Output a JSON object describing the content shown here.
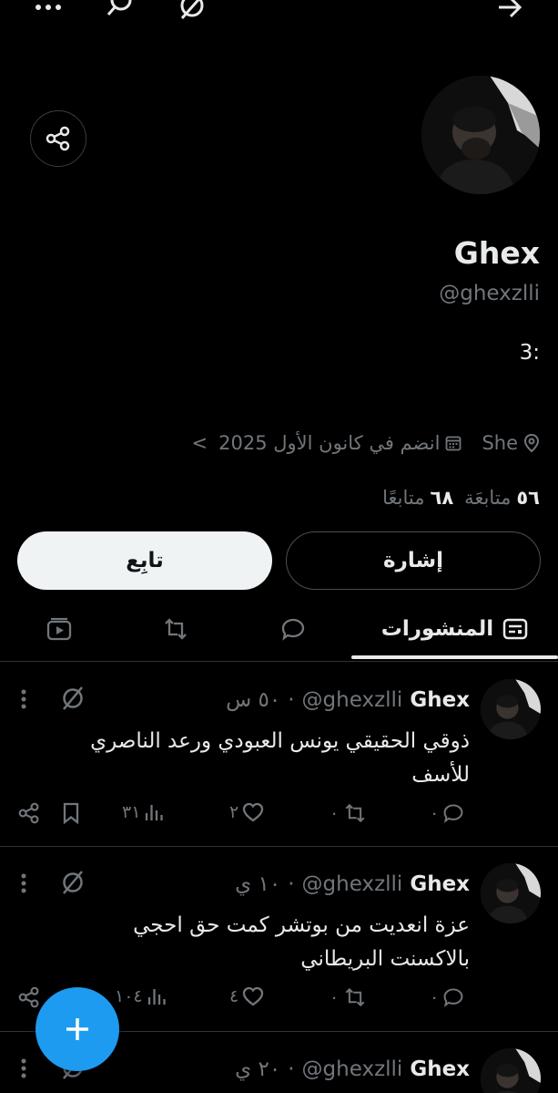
{
  "topbar": {
    "icons": [
      "more-icon",
      "search-icon",
      "grok-icon",
      "back-arrow-icon"
    ]
  },
  "profile": {
    "name": "Ghex",
    "handle": "@ghexzlli",
    "bio": "3:",
    "location": "She",
    "joined": "انضم في كانون الأول 2025",
    "joined_chevron": "<",
    "following_count": "٥٦",
    "following_label": "متابعَة",
    "followers_count": "٦٨",
    "followers_label": "متابعًا"
  },
  "buttons": {
    "mention": "إشارة",
    "follow": "تابِع"
  },
  "tabs": {
    "posts_label": "المنشورات"
  },
  "posts": [
    {
      "name": "Ghex",
      "handle": "@ghexzlli",
      "time": "٥٠ س",
      "dot": "·",
      "text": "ذوقي الحقيقي يونس العبودي ورعد الناصري للأسف",
      "replies": "٠",
      "reposts": "٠",
      "likes": "٢",
      "views": "٣١"
    },
    {
      "name": "Ghex",
      "handle": "@ghexzlli",
      "time": "١٠ ي",
      "dot": "·",
      "text": "عزة انعديت من بوتشر كمت حق احجي بالاكسنت البريطاني",
      "replies": "٠",
      "reposts": "٠",
      "likes": "٤",
      "views": "١٠٤"
    },
    {
      "name": "Ghex",
      "handle": "@ghexzlli",
      "time": "٢٠ ي",
      "dot": "·"
    }
  ],
  "colors": {
    "background": "#000000",
    "text": "#e7e9ea",
    "muted": "#71767b",
    "accent": "#1d9bf0",
    "border": "#2f3336"
  }
}
